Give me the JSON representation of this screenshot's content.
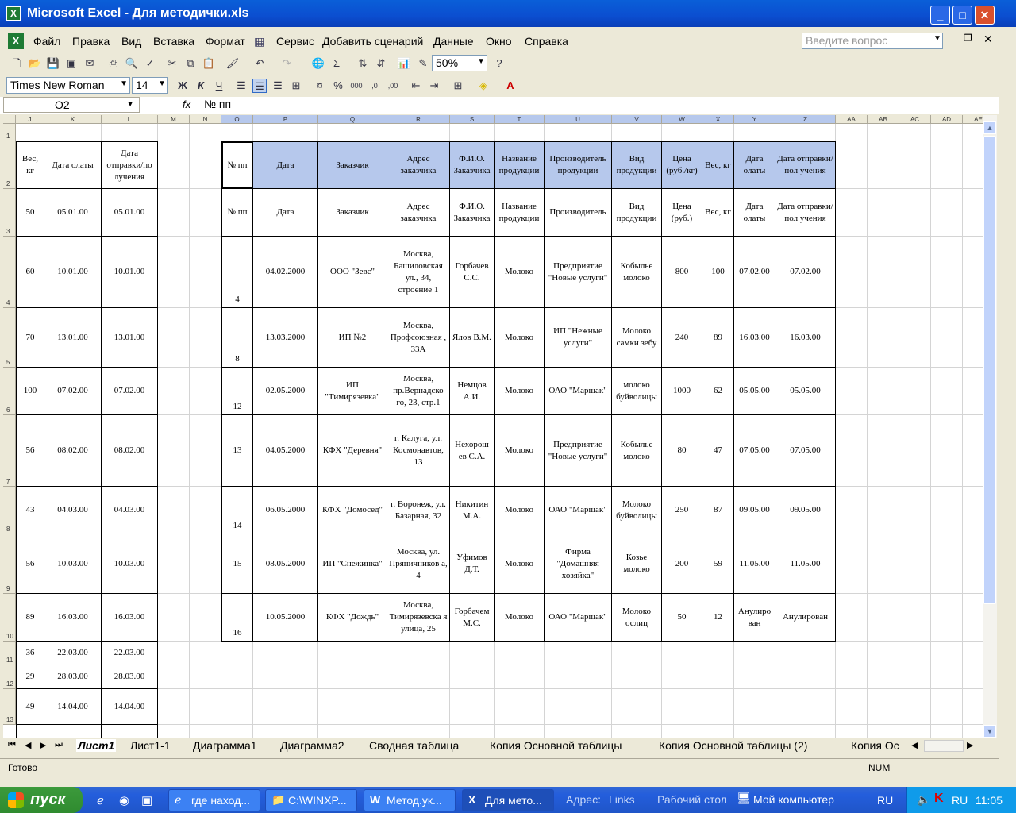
{
  "window": {
    "title": "Microsoft Excel - Для методички.xls"
  },
  "menu": [
    "Файл",
    "Правка",
    "Вид",
    "Вставка",
    "Формат",
    "Сервис",
    "Добавить сценарий",
    "Данные",
    "Окно",
    "Справка"
  ],
  "help_placeholder": "Введите вопрос",
  "toolbar": {
    "zoom": "50%",
    "font": "Times New Roman",
    "size": "14",
    "bold": "Ж",
    "italic": "К",
    "underline": "Ч"
  },
  "formula_bar": {
    "namebox": "O2",
    "fx": "fx",
    "value": "№ пп"
  },
  "columns": [
    "J",
    "K",
    "L",
    "M",
    "N",
    "O",
    "P",
    "Q",
    "R",
    "S",
    "T",
    "U",
    "V",
    "W",
    "X",
    "Y",
    "Z",
    "AA",
    "AB",
    "AC",
    "AD",
    "AE"
  ],
  "rows": [
    "1",
    "2",
    "3",
    "4",
    "5",
    "6",
    "7",
    "8",
    "9",
    "10",
    "11",
    "12",
    "13"
  ],
  "left_table": {
    "headers": [
      "Вес, кг",
      "Дата олаты",
      "Дата отправки/по лучения"
    ],
    "rows": [
      [
        "50",
        "05.01.00",
        "05.01.00"
      ],
      [
        "60",
        "10.01.00",
        "10.01.00"
      ],
      [
        "70",
        "13.01.00",
        "13.01.00"
      ],
      [
        "100",
        "07.02.00",
        "07.02.00"
      ],
      [
        "56",
        "08.02.00",
        "08.02.00"
      ],
      [
        "43",
        "04.03.00",
        "04.03.00"
      ],
      [
        "56",
        "10.03.00",
        "10.03.00"
      ],
      [
        "89",
        "16.03.00",
        "16.03.00"
      ],
      [
        "36",
        "22.03.00",
        "22.03.00"
      ],
      [
        "29",
        "28.03.00",
        "28.03.00"
      ],
      [
        "49",
        "14.04.00",
        "14.04.00"
      ]
    ]
  },
  "main_table": {
    "headers": [
      "№ пп",
      "Дата",
      "Заказчик",
      "Адрес заказчика",
      "Ф.И.О. Заказчика",
      "Название продукции",
      "Производитель продукции",
      "Вид продукции",
      "Цена (руб./кг)",
      "Вес, кг",
      "Дата олаты",
      "Дата отправки/пол учения"
    ],
    "subheaders": [
      "№ пп",
      "Дата",
      "Заказчик",
      "Адрес заказчика",
      "Ф.И.О. Заказчика",
      "Название продукции",
      "Производитель",
      "Вид продукции",
      "Цена (руб.)",
      "Вес, кг",
      "Дата олаты",
      "Дата отправки/пол учения"
    ],
    "rows": [
      [
        "4",
        "04.02.2000",
        "ООО \"Зевс\"",
        "Москва, Башиловская ул., 34, строение 1",
        "Горбачев С.С.",
        "Молоко",
        "Предприятие \"Новые услуги\"",
        "Кобылье молоко",
        "800",
        "100",
        "07.02.00",
        "07.02.00"
      ],
      [
        "8",
        "13.03.2000",
        "ИП №2",
        "Москва, Профсоюзная , 33А",
        "Ялов В.М.",
        "Молоко",
        "ИП \"Нежные услуги\"",
        "Молоко самки зебу",
        "240",
        "89",
        "16.03.00",
        "16.03.00"
      ],
      [
        "12",
        "02.05.2000",
        "ИП \"Тимирязевка\"",
        "Москва, пр.Вернадско го, 23, стр.1",
        "Немцов А.И.",
        "Молоко",
        "ОАО \"Маршак\"",
        "молоко буйволицы",
        "1000",
        "62",
        "05.05.00",
        "05.05.00"
      ],
      [
        "13",
        "04.05.2000",
        "КФХ \"Деревня\"",
        "г. Калуга, ул. Космонавтов, 13",
        "Нехорош ев С.А.",
        "Молоко",
        "Предприятие \"Новые услуги\"",
        "Кобылье молоко",
        "80",
        "47",
        "07.05.00",
        "07.05.00"
      ],
      [
        "14",
        "06.05.2000",
        "КФХ \"Домосед\"",
        "г. Воронеж, ул. Базарная, 32",
        "Никитин М.А.",
        "Молоко",
        "ОАО \"Маршак\"",
        "Молоко буйволицы",
        "250",
        "87",
        "09.05.00",
        "09.05.00"
      ],
      [
        "15",
        "08.05.2000",
        "ИП \"Снежинка\"",
        "Москва, ул. Пряничников а, 4",
        "Уфимов Д.Т.",
        "Молоко",
        "Фирма \"Домашняя хозяйка\"",
        "Козье молоко",
        "200",
        "59",
        "11.05.00",
        "11.05.00"
      ],
      [
        "16",
        "10.05.2000",
        "КФХ \"Дождь\"",
        "Москва, Тимирязевска я улица, 25",
        "Горбачем М.С.",
        "Молоко",
        "ОАО \"Маршак\"",
        "Молоко ослиц",
        "50",
        "12",
        "Анулиро ван",
        "Анулирован"
      ]
    ]
  },
  "sheet_tabs": [
    "Лист1",
    "Лист1-1",
    "Диаграмма1",
    "Диаграмма2",
    "Сводная таблица",
    "Копия Основной таблицы",
    "Копия Основной таблицы (2)",
    "Копия Ос"
  ],
  "status": {
    "left": "Готово",
    "num": "NUM"
  },
  "taskbar": {
    "start": "пуск",
    "tasks": [
      "где наход...",
      "C:\\WINXP...",
      "Метод.ук...",
      "Для мето..."
    ],
    "address_label": "Адрес:",
    "links": "Links",
    "desktop": "Рабочий стол",
    "mycomputer": "Мой компьютер",
    "lang": "RU",
    "lang2": "RU",
    "clock": "11:05"
  }
}
